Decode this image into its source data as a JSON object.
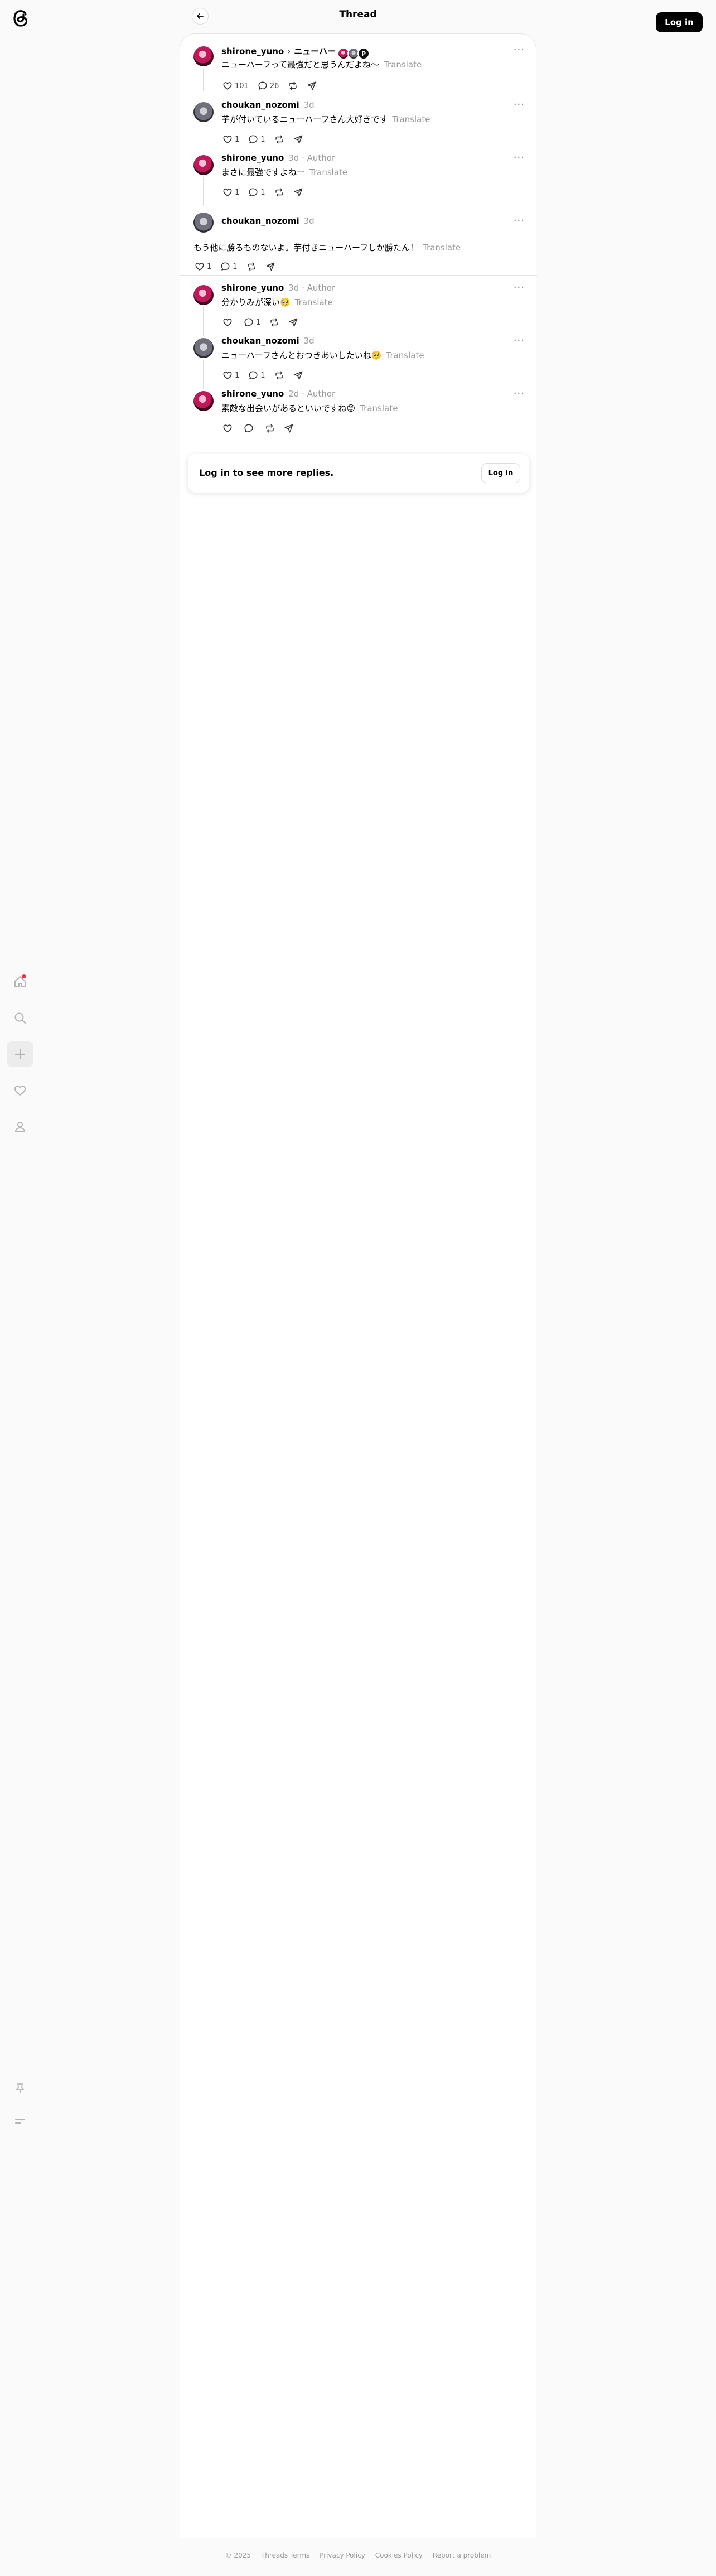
{
  "header": {
    "title": "Thread",
    "login_label": "Log in"
  },
  "sidebar": {
    "items": [
      {
        "name": "home",
        "active": false,
        "notification": true
      },
      {
        "name": "search",
        "active": false
      },
      {
        "name": "create",
        "active": true
      },
      {
        "name": "activity",
        "active": false
      },
      {
        "name": "profile",
        "active": false
      }
    ],
    "bottom": [
      "pin",
      "menu"
    ]
  },
  "posts": [
    {
      "username": "shirone_yuno",
      "topic": "ニューハー",
      "mini_avatars_more": "P",
      "text": "ニューハーフって最強だと思うんだよね～",
      "translate": "Translate",
      "likes": "101",
      "replies": "26",
      "avatar": "pink"
    },
    {
      "username": "choukan_nozomi",
      "time": "3d",
      "text": "芋が付いているニューハーフさん大好きです",
      "translate": "Translate",
      "likes": "1",
      "replies": "1",
      "avatar": "gray"
    },
    {
      "username": "shirone_yuno",
      "time": "3d",
      "author": "Author",
      "text": "まさに最強ですよねー",
      "translate": "Translate",
      "likes": "1",
      "replies": "1",
      "avatar": "pink"
    },
    {
      "username": "choukan_nozomi",
      "time": "3d",
      "text": "もう他に勝るものないよ。芋付きニューハーフしか勝たん！",
      "translate": "Translate",
      "likes": "1",
      "replies": "1",
      "avatar": "gray"
    },
    {
      "username": "shirone_yuno",
      "time": "3d",
      "author": "Author",
      "text": "分かりみが深い🥹",
      "translate": "Translate",
      "likes": "",
      "replies": "1",
      "avatar": "pink"
    },
    {
      "username": "choukan_nozomi",
      "time": "3d",
      "text": "ニューハーフさんとおつきあいしたいね🥹",
      "translate": "Translate",
      "likes": "1",
      "replies": "1",
      "avatar": "gray"
    },
    {
      "username": "shirone_yuno",
      "time": "2d",
      "author": "Author",
      "text": "素敵な出会いがあるといいですね😊",
      "translate": "Translate",
      "likes": "",
      "replies": "",
      "avatar": "pink"
    }
  ],
  "login_card": {
    "text": "Log in to see more replies.",
    "button": "Log in"
  },
  "footer": {
    "copyright": "© 2025",
    "links": [
      "Threads Terms",
      "Privacy Policy",
      "Cookies Policy",
      "Report a problem"
    ]
  },
  "colors": {
    "accent": "#000000",
    "notification": "#ff3040",
    "muted": "#999999"
  }
}
